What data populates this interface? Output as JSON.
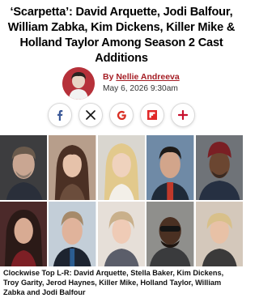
{
  "article": {
    "headline": "‘Scarpetta’: David Arquette, Jodi Balfour, William Zabka, Kim Dickens, Killer Mike & Holland Taylor Among Season 2 Cast Additions",
    "byline_prefix": "By ",
    "author": "Nellie Andreeva",
    "date": "May 6, 2026 9:30am",
    "caption": "Clockwise Top L-R: David Arquette, Stella Baker, Kim Dickens, Troy Garity, Jerod Haynes, Killer Mike, Holland Taylor, William Zabka and Jodi Balfour"
  },
  "share": [
    {
      "name": "facebook-share-button",
      "icon": "facebook-icon",
      "glyph": "f",
      "color": "#3b5998"
    },
    {
      "name": "x-share-button",
      "icon": "x-icon",
      "glyph": "X",
      "color": "#111111"
    },
    {
      "name": "google-share-button",
      "icon": "google-icon",
      "glyph": "G",
      "color": "#d93025"
    },
    {
      "name": "flipboard-share-button",
      "icon": "flipboard-icon",
      "glyph": "F",
      "color": "#e12828"
    },
    {
      "name": "more-share-button",
      "icon": "plus-icon",
      "glyph": "+",
      "color": "#c8102e"
    }
  ],
  "colors": {
    "accent": "#a51d24",
    "brand_red": "#c8102e"
  }
}
